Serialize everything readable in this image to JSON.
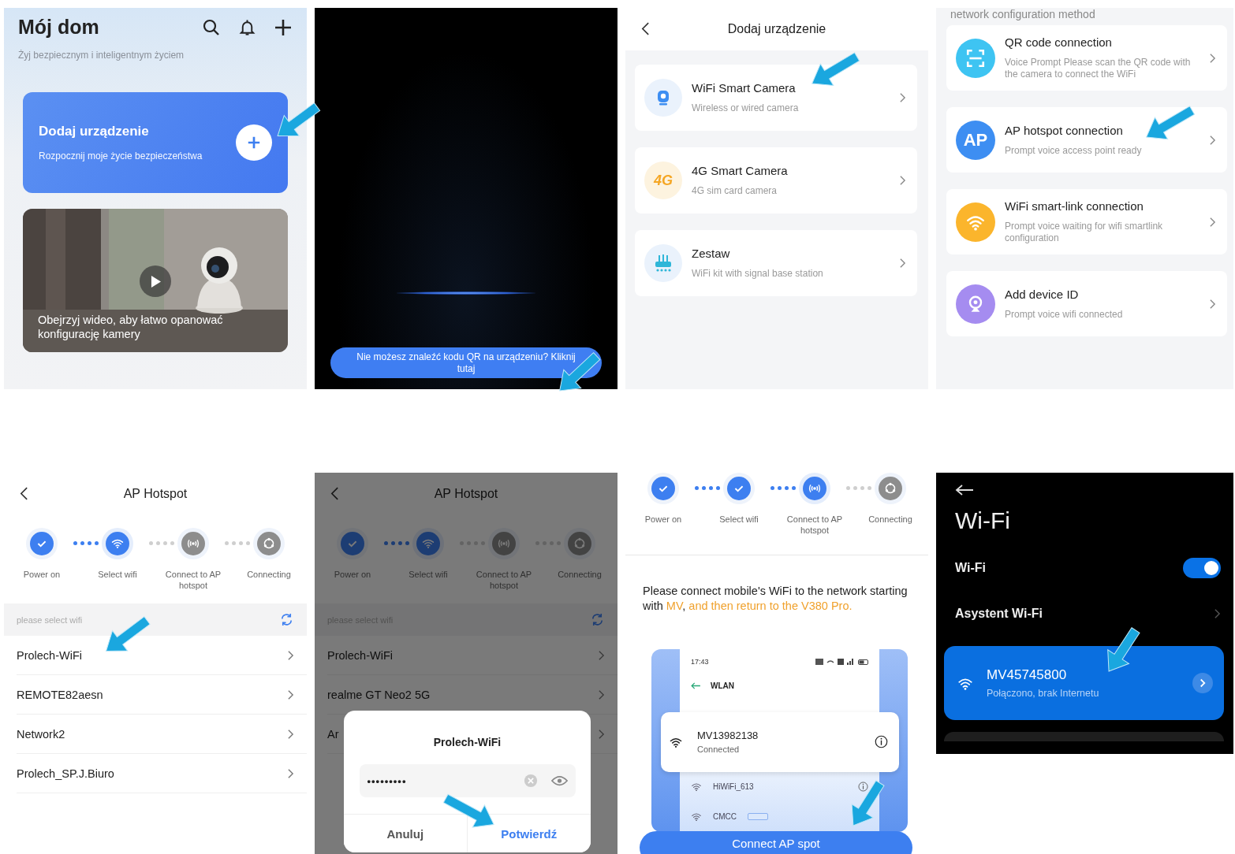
{
  "panels": [
    {
      "kind": "home",
      "title": "Mój dom",
      "subtitle": "Żyj bezpiecznym i inteligentnym życiem",
      "add_card": {
        "title": "Dodaj urządzenie",
        "subtitle": "Rozpocznij moje życie bezpieczeństwa"
      },
      "video_card": {
        "kind": "picture",
        "caption": "Obejrzyj wideo, aby łatwo opanować konfigurację kamery"
      }
    },
    {
      "kind": "scanner",
      "hint_button": "Nie możesz znaleźć kodu QR na urządzeniu? Kliknij tutaj"
    },
    {
      "kind": "device_types",
      "title": "Dodaj urządzenie",
      "items": [
        {
          "kind": "camera",
          "name": "WiFi Smart Camera",
          "description": "Wireless or wired camera"
        },
        {
          "kind": "cellular",
          "icon_text": "4G",
          "name": "4G Smart Camera",
          "description": "4G sim card camera"
        },
        {
          "kind": "kit",
          "name": "Zestaw",
          "description": "WiFi kit with signal base station"
        }
      ]
    },
    {
      "kind": "methods",
      "heading": "network configuration method",
      "items": [
        {
          "kind": "qr",
          "color": "#3ec4f2",
          "name": "QR code connection",
          "description": "Voice Prompt Please scan the QR code with the camera to connect the WiFi"
        },
        {
          "kind": "ap",
          "icon_text": "AP",
          "color": "#3d8ef2",
          "name": "AP hotspot connection",
          "description": "Prompt voice access point ready"
        },
        {
          "kind": "smartlink",
          "color": "#fbb52c",
          "name": "WiFi smart-link connection",
          "description": "Prompt voice waiting for wifi smartlink configuration"
        },
        {
          "kind": "device_id",
          "color": "#a58cf0",
          "name": "Add device ID",
          "description": "Prompt voice wifi connected"
        }
      ]
    },
    {
      "kind": "wifi_list",
      "title": "AP Hotspot",
      "steps": [
        {
          "label": "Power on",
          "done": true,
          "current": false
        },
        {
          "kind": "wifi",
          "label": "Select wifi",
          "done": false,
          "current": true
        },
        {
          "kind": "hotspot",
          "label": "Connect to AP hotspot",
          "done": false,
          "current": false
        },
        {
          "kind": "connect",
          "label": "Connecting",
          "done": false,
          "current": false
        }
      ],
      "section": "please select wifi",
      "networks": [
        "Prolech-WiFi",
        "REMOTE82aesn",
        "Network2",
        "Prolech_SP.J.Biuro"
      ]
    },
    {
      "kind": "wifi_dialog",
      "title": "AP Hotspot",
      "steps": [
        {
          "label": "Power on",
          "done": true,
          "current": false
        },
        {
          "kind": "wifi",
          "label": "Select wifi",
          "done": false,
          "current": true
        },
        {
          "kind": "hotspot",
          "label": "Connect to AP hotspot",
          "done": false,
          "current": false
        },
        {
          "kind": "connect",
          "label": "Connecting",
          "done": false,
          "current": false
        }
      ],
      "section": "please select wifi",
      "networks": [
        "Prolech-WiFi",
        "realme GT Neo2 5G",
        "Ar"
      ],
      "dialog": {
        "title": "Prolech-WiFi",
        "password": "•••••••••",
        "cancel": "Anuluj",
        "confirm": "Potwierdź"
      }
    },
    {
      "kind": "connect_ap",
      "steps": [
        {
          "label": "Power on",
          "done": true,
          "current": false
        },
        {
          "label": "Select wifi",
          "done": true,
          "current": false
        },
        {
          "kind": "hotspot",
          "label": "Connect to AP hotspot",
          "done": false,
          "current": true
        },
        {
          "kind": "connect",
          "label": "Connecting",
          "done": false,
          "current": false
        }
      ],
      "instruction": [
        {
          "text": "Please connect mobile's WiFi to the network starting with ",
          "highlight": false
        },
        {
          "text": "MV",
          "highlight": true
        },
        {
          "text": ", ",
          "highlight": false
        },
        {
          "text": "and then return to the V380 Pro.",
          "highlight": true
        }
      ],
      "illustration": {
        "time": "17:43",
        "screen_title": "WLAN",
        "connected": {
          "name": "MV13982138",
          "status": "Connected"
        },
        "others": [
          "HiWiFi_613",
          "CMCC"
        ]
      },
      "button": "Connect AP spot"
    },
    {
      "kind": "android_wifi",
      "title": "Wi-Fi",
      "toggle_label": "Wi-Fi",
      "toggle_on": true,
      "assistant": "Asystent Wi-Fi",
      "network": {
        "name": "MV45745800",
        "status": "Połączono, brak Internetu"
      }
    }
  ]
}
